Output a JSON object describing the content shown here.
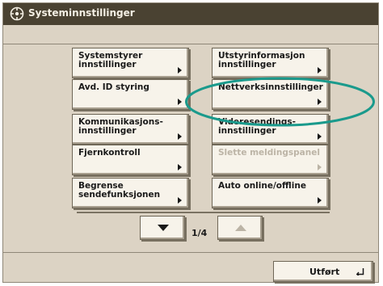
{
  "window": {
    "title": "Systeminnstillinger",
    "title_icon": "settings-gear-icon"
  },
  "buttons": [
    {
      "id": "systemstyrer",
      "label": "Systemstyrer\ninnstillinger",
      "enabled": true
    },
    {
      "id": "utstyrinformasjon",
      "label": "Utstyrinformasjon\ninnstillinger",
      "enabled": true
    },
    {
      "id": "avd-id",
      "label": "Avd. ID styring",
      "enabled": true
    },
    {
      "id": "nettverk",
      "label": "Nettverksinnstillinger",
      "enabled": true,
      "highlighted": true
    },
    {
      "id": "kommunikasjon",
      "label": "Kommunikasjons-\ninnstillinger",
      "enabled": true
    },
    {
      "id": "videresending",
      "label": "Videresendings-\ninnstillinger",
      "enabled": true
    },
    {
      "id": "fjernkontroll",
      "label": "Fjernkontroll",
      "enabled": true
    },
    {
      "id": "slette",
      "label": "Slette meldingspanel",
      "enabled": false
    },
    {
      "id": "begrense",
      "label": "Begrense\nsendefunksjonen",
      "enabled": true
    },
    {
      "id": "auto-online",
      "label": "Auto online/offline",
      "enabled": true
    }
  ],
  "pagination": {
    "current": 1,
    "total": 4,
    "text": "1/4",
    "prev_enabled": false,
    "next_enabled": true
  },
  "footer": {
    "done_label": "Utført",
    "done_icon": "return-arrow-icon"
  },
  "colors": {
    "titlebar": "#4a4232",
    "panel": "#dcd3c4",
    "button": "#f7f3ea",
    "highlight_oval": "#1a9a8c",
    "disabled_text": "#bcb4a6"
  }
}
